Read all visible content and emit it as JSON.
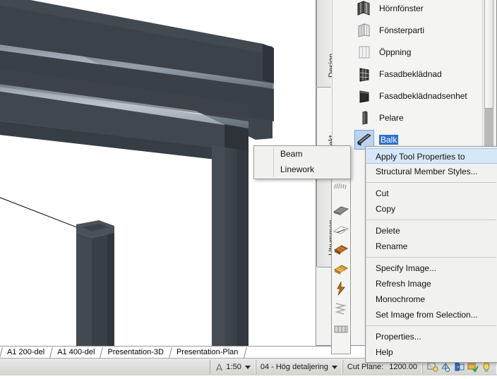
{
  "viewport": {
    "name": "3d-model-viewport",
    "description": "3D isometric view of a steel I-beam supported by two rectangular columns with a leader line",
    "background_color": "#ffffff",
    "beam_color": "#3d434a",
    "column_color": "#3f444b"
  },
  "layout_tabs": [
    {
      "label": "A1 200-del"
    },
    {
      "label": "A1 400-del"
    },
    {
      "label": "Presentation-3D"
    },
    {
      "label": "Presentation-Plan"
    }
  ],
  "palette": {
    "vertical_tabs": [
      {
        "label": "Design",
        "active": false
      },
      {
        "label": "olymobjekt",
        "active": true
      },
      {
        "label": "Utrymmen",
        "active": false
      }
    ],
    "tools": [
      {
        "label": "Hörnfönster",
        "icon": "corner-window-icon",
        "selected": false
      },
      {
        "label": "Fönsterparti",
        "icon": "window-assembly-icon",
        "selected": false
      },
      {
        "label": "Öppning",
        "icon": "opening-icon",
        "selected": false
      },
      {
        "label": "Fasadbeklädnad",
        "icon": "curtain-wall-icon",
        "selected": false
      },
      {
        "label": "Fasadbeklädnadsenhet",
        "icon": "curtain-wall-unit-icon",
        "selected": false
      },
      {
        "label": "Pelare",
        "icon": "column-icon",
        "selected": false
      },
      {
        "label": "Balk",
        "icon": "beam-icon",
        "selected": true
      }
    ],
    "strip_icons": [
      "rain-icon",
      "slab-gray-icon",
      "slab-white-icon",
      "brick-icon",
      "wood-panel-icon",
      "bolt-icon",
      "zigzag-icon",
      "railing-icon"
    ]
  },
  "context_menu": {
    "name": "tool-context-menu",
    "items": [
      {
        "label": "Apply Tool Properties to",
        "highlighted": true,
        "submenu": true
      },
      {
        "label": "Structural Member Styles...",
        "highlighted": false
      },
      {
        "separator": true
      },
      {
        "label": "Cut",
        "highlighted": false
      },
      {
        "label": "Copy",
        "highlighted": false
      },
      {
        "separator": true
      },
      {
        "label": "Delete",
        "highlighted": false
      },
      {
        "label": "Rename",
        "highlighted": false
      },
      {
        "separator": true
      },
      {
        "label": "Specify Image...",
        "highlighted": false
      },
      {
        "label": "Refresh Image",
        "highlighted": false
      },
      {
        "label": "Monochrome",
        "highlighted": false
      },
      {
        "label": "Set Image from Selection...",
        "highlighted": false
      },
      {
        "separator": true
      },
      {
        "label": "Properties...",
        "highlighted": false
      },
      {
        "label": "Help",
        "highlighted": false
      }
    ]
  },
  "submenu": {
    "name": "apply-tool-properties-submenu",
    "items": [
      {
        "label": "Beam"
      },
      {
        "label": "Linework"
      }
    ]
  },
  "status_bar": {
    "scale": "1:50",
    "detail_level": "04 - Hög detaljering",
    "cut_plane_label": "Cut Plane:",
    "cut_plane_value": "1200.00",
    "icons": [
      "isolate-objects-icon",
      "surface-hatch-icon",
      "constrain-icon",
      "layer-state-icon",
      "lightbulb-icon"
    ]
  },
  "colors": {
    "menu_bg": "#f1f1ef",
    "highlight_bg": "#d6e7f8",
    "selection_blue": "#2f6fd0",
    "palette_bg": "#f4f4f2",
    "status_bar_bg": "#e0e0dd"
  }
}
